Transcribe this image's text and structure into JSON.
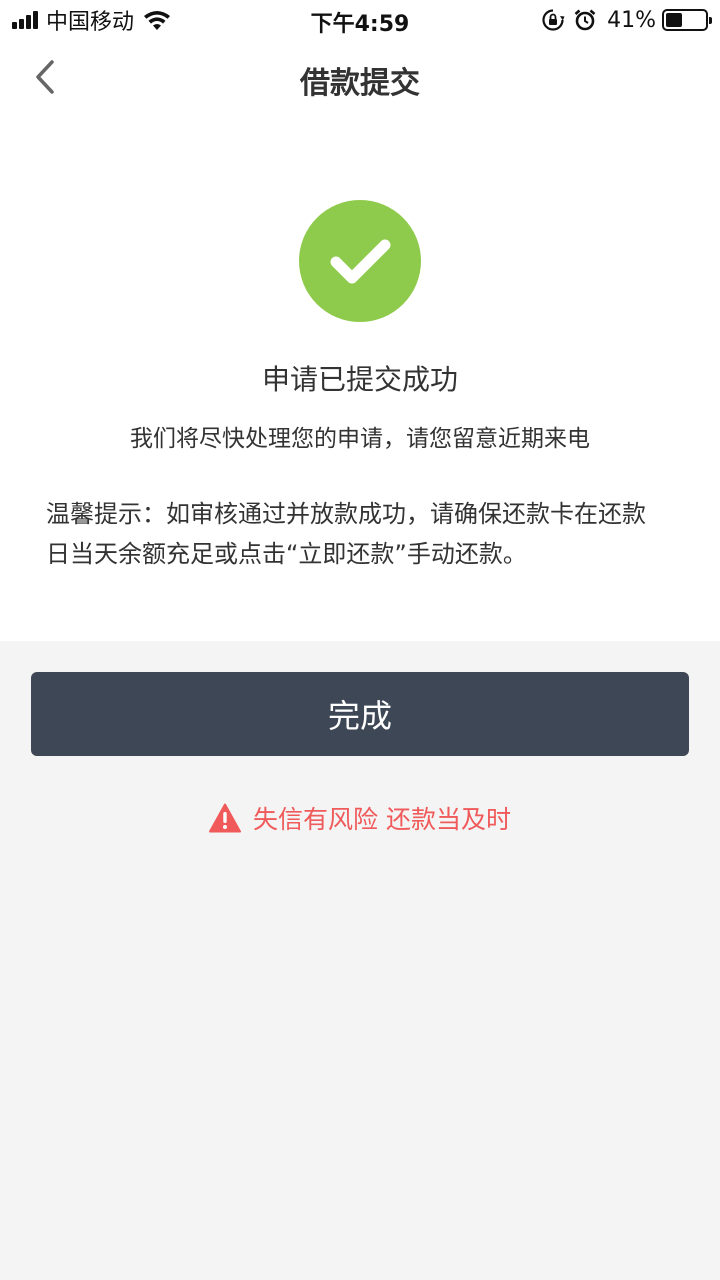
{
  "status_bar": {
    "carrier": "中国移动",
    "time": "下午4:59",
    "battery_percent": "41%",
    "battery_level": 0.41,
    "icons": [
      "signal-icon",
      "wifi-icon",
      "rotation-lock-icon",
      "alarm-icon",
      "battery-icon"
    ]
  },
  "nav": {
    "title": "借款提交",
    "back_icon": "chevron-left-icon"
  },
  "result": {
    "icon": "check-circle-icon",
    "icon_color": "#8ecb4c",
    "title": "申请已提交成功",
    "description": "我们将尽快处理您的申请，请您留意近期来电",
    "tip": "温馨提示：如审核通过并放款成功，请确保还款卡在还款日当天余额充足或点击“立即还款”手动还款。"
  },
  "actions": {
    "done_label": "完成",
    "done_color": "#3e4756"
  },
  "warning": {
    "icon": "warning-triangle-icon",
    "text": "失信有风险 还款当及时",
    "color": "#f05a5a"
  }
}
